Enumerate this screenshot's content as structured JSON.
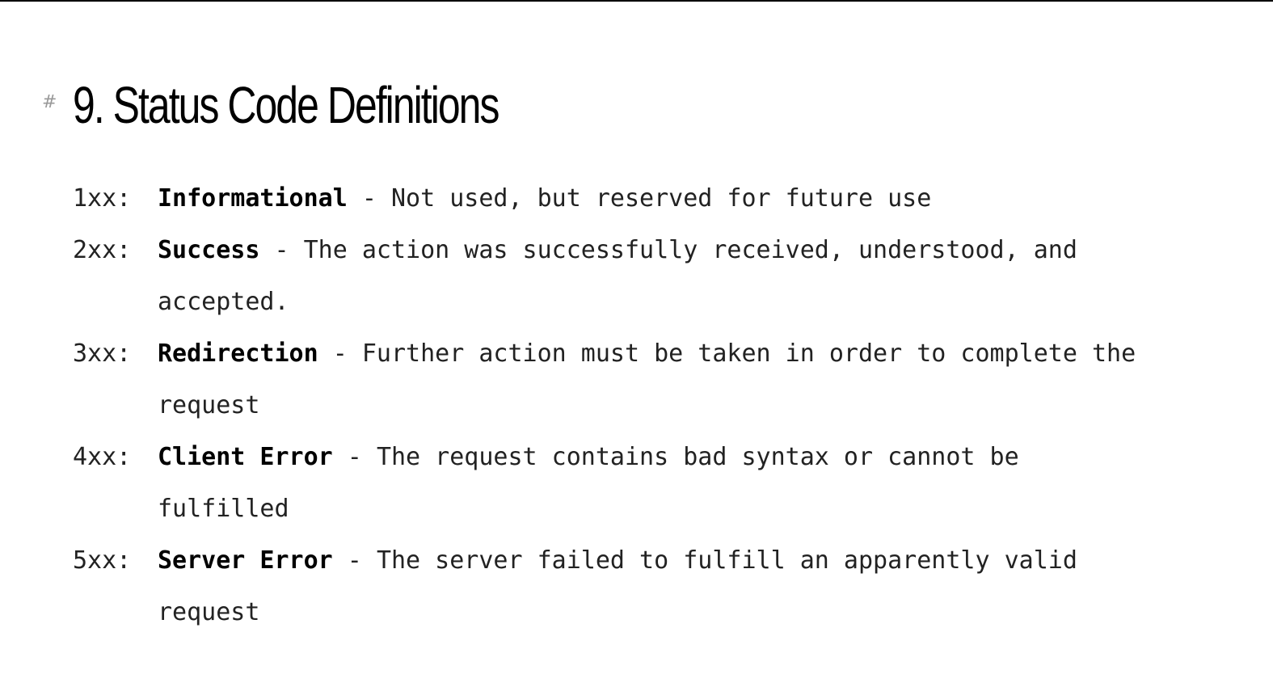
{
  "heading": {
    "anchor": "#",
    "title": "9. Status Code Definitions"
  },
  "status_codes": [
    {
      "code": "1xx:",
      "name": "Informational",
      "separator": " - ",
      "description": "Not used, but reserved for future use"
    },
    {
      "code": "2xx:",
      "name": "Success",
      "separator": " - ",
      "description": "The action was successfully received, understood, and accepted."
    },
    {
      "code": "3xx:",
      "name": "Redirection",
      "separator": " - ",
      "description": "Further action must be taken in order to complete the request"
    },
    {
      "code": "4xx:",
      "name": "Client Error",
      "separator": " - ",
      "description": "The request contains bad syntax or cannot be fulfilled"
    },
    {
      "code": "5xx:",
      "name": "Server Error",
      "separator": " - ",
      "description": "The server failed to fulfill an apparently valid request"
    }
  ]
}
